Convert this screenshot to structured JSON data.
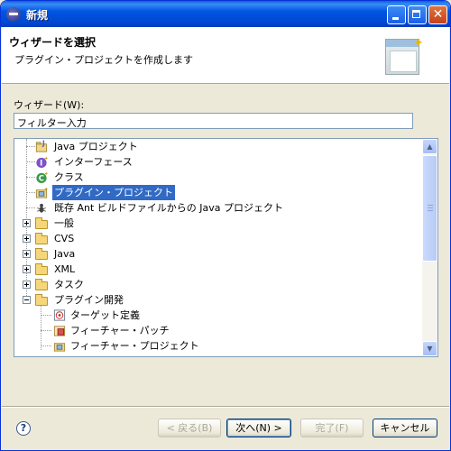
{
  "window": {
    "title": "新規"
  },
  "banner": {
    "title": "ウィザードを選択",
    "description": "プラグイン・プロジェクトを作成します"
  },
  "wizards_label": "ウィザード(W):",
  "filter": {
    "placeholder": "フィルター入力",
    "value": ""
  },
  "tree": [
    {
      "label": "Java プロジェクト",
      "icon": "java-project-icon"
    },
    {
      "label": "インターフェース",
      "icon": "interface-icon"
    },
    {
      "label": "クラス",
      "icon": "class-icon"
    },
    {
      "label": "プラグイン・プロジェクト",
      "icon": "plugin-project-icon",
      "selected": true
    },
    {
      "label": "既存 Ant ビルドファイルからの Java プロジェクト",
      "icon": "ant-icon"
    },
    {
      "label": "一般",
      "icon": "folder-icon",
      "expanded": false
    },
    {
      "label": "CVS",
      "icon": "folder-icon",
      "expanded": false
    },
    {
      "label": "Java",
      "icon": "folder-icon",
      "expanded": false
    },
    {
      "label": "XML",
      "icon": "folder-icon",
      "expanded": false
    },
    {
      "label": "タスク",
      "icon": "folder-icon",
      "expanded": false
    },
    {
      "label": "プラグイン開発",
      "icon": "folder-open-icon",
      "expanded": true
    },
    {
      "label": "ターゲット定義",
      "icon": "target-definition-icon"
    },
    {
      "label": "フィーチャー・パッチ",
      "icon": "feature-patch-icon"
    },
    {
      "label": "フィーチャー・プロジェクト",
      "icon": "feature-project-icon"
    }
  ],
  "buttons": {
    "back": "< 戻る(B)",
    "next": "次へ(N) >",
    "finish": "完了(F)",
    "cancel": "キャンセル"
  },
  "colors": {
    "titlebar": "#0054e3",
    "selection": "#316ac5",
    "dialog_bg": "#ece9d8"
  }
}
